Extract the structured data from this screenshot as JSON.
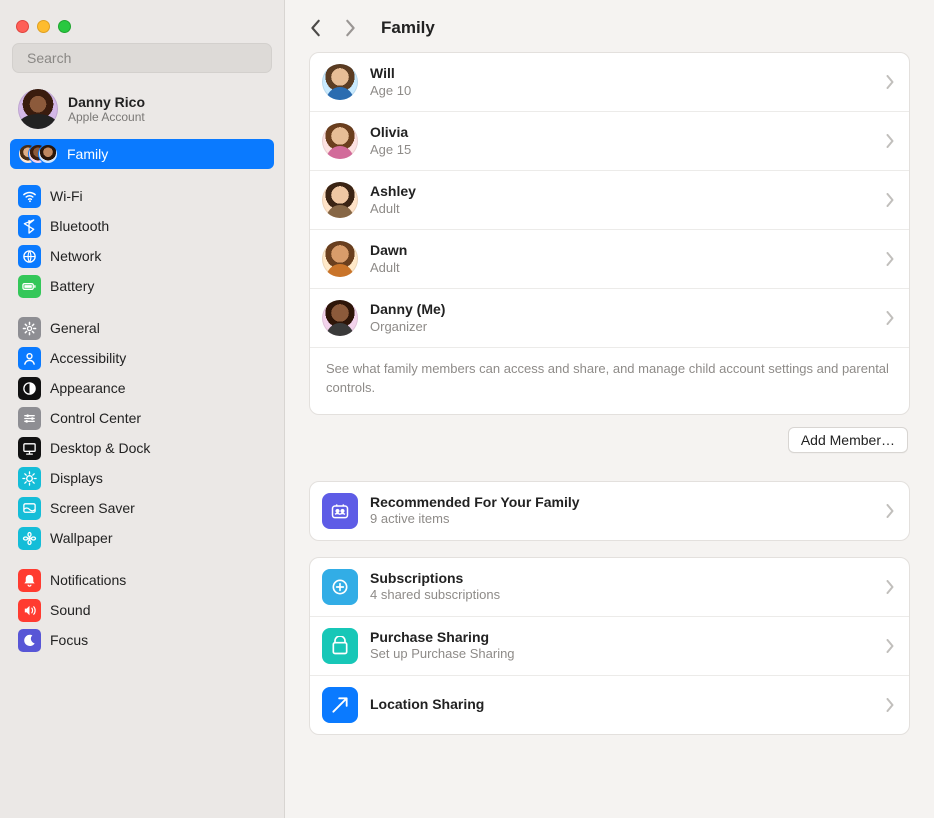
{
  "search": {
    "placeholder": "Search"
  },
  "account": {
    "name": "Danny Rico",
    "sub": "Apple Account"
  },
  "sidebar": {
    "family_label": "Family",
    "groups": [
      [
        {
          "label": "Wi-Fi",
          "color": "ic-blue",
          "icon": "wifi"
        },
        {
          "label": "Bluetooth",
          "color": "ic-blue",
          "icon": "bluetooth"
        },
        {
          "label": "Network",
          "color": "ic-blue",
          "icon": "globe"
        },
        {
          "label": "Battery",
          "color": "ic-green",
          "icon": "battery"
        }
      ],
      [
        {
          "label": "General",
          "color": "ic-grey",
          "icon": "gear"
        },
        {
          "label": "Accessibility",
          "color": "ic-blue",
          "icon": "person"
        },
        {
          "label": "Appearance",
          "color": "ic-black",
          "icon": "contrast"
        },
        {
          "label": "Control Center",
          "color": "ic-grey",
          "icon": "sliders"
        },
        {
          "label": "Desktop & Dock",
          "color": "ic-black",
          "icon": "desktop"
        },
        {
          "label": "Displays",
          "color": "ic-teal",
          "icon": "sun"
        },
        {
          "label": "Screen Saver",
          "color": "ic-teal",
          "icon": "screensaver"
        },
        {
          "label": "Wallpaper",
          "color": "ic-teal",
          "icon": "flower"
        }
      ],
      [
        {
          "label": "Notifications",
          "color": "ic-red",
          "icon": "bell"
        },
        {
          "label": "Sound",
          "color": "ic-red",
          "icon": "speaker"
        },
        {
          "label": "Focus",
          "color": "ic-indigo",
          "icon": "moon"
        }
      ]
    ]
  },
  "page": {
    "title": "Family"
  },
  "members": [
    {
      "name": "Will",
      "sub": "Age 10",
      "avatar": "av-will"
    },
    {
      "name": "Olivia",
      "sub": "Age 15",
      "avatar": "av-olivia"
    },
    {
      "name": "Ashley",
      "sub": "Adult",
      "avatar": "av-ashley"
    },
    {
      "name": "Dawn",
      "sub": "Adult",
      "avatar": "av-dawn"
    },
    {
      "name": "Danny (Me)",
      "sub": "Organizer",
      "avatar": "av-danny"
    }
  ],
  "members_footer": "See what family members can access and share, and manage child account settings and parental controls.",
  "add_member_label": "Add Member…",
  "recommended": {
    "title": "Recommended For Your Family",
    "sub": "9 active items"
  },
  "sharing": [
    {
      "title": "Subscriptions",
      "sub": "4 shared subscriptions",
      "color": "sq-sky",
      "icon": "plus-circle"
    },
    {
      "title": "Purchase Sharing",
      "sub": "Set up Purchase Sharing",
      "color": "sq-teal",
      "icon": "bag"
    },
    {
      "title": "Location Sharing",
      "sub": "",
      "color": "sq-blue",
      "icon": "arrow"
    }
  ]
}
